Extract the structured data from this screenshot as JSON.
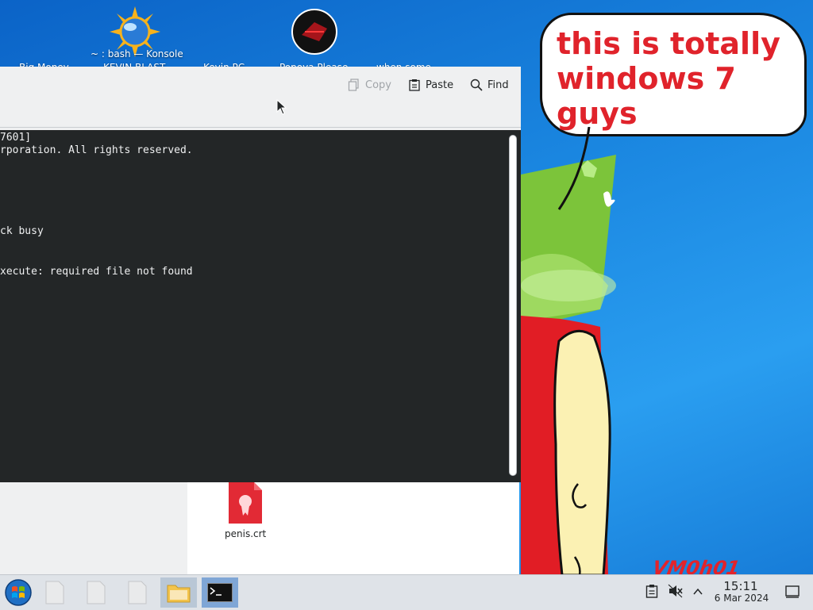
{
  "desktop": {
    "icon_labels": [
      "Big Money",
      "KEVIN BLAST",
      "Kevin PC",
      "Popoya Please",
      "when some"
    ],
    "konsole_icon_label": "~ : bash — Konsole"
  },
  "bubble": {
    "text_line1": "this is totally",
    "text_line2": "windows 7 guys",
    "watermark": "VM0h01"
  },
  "konsole": {
    "toolbar": {
      "copy_label": "Copy",
      "paste_label": "Paste",
      "find_label": "Find"
    },
    "terminal_lines": [
      "7601]",
      "rporation. All rights reserved.",
      "ck busy",
      "xecute: required file not found"
    ]
  },
  "files": {
    "items": [
      {
        "name": "penis.crt"
      }
    ]
  },
  "taskbar": {
    "time": "15:11",
    "date": "6 Mar 2024"
  },
  "colors": {
    "accent_red": "#e0232b",
    "terminal_bg": "#232627",
    "desktop_blue": "#1a86e0"
  }
}
